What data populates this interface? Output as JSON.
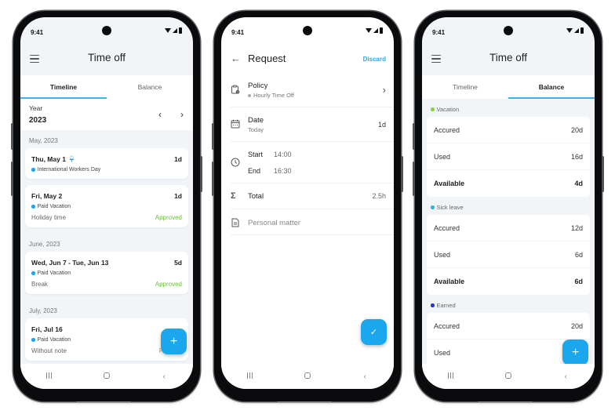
{
  "status_bar": {
    "time": "9:41"
  },
  "screen1": {
    "title": "Time off",
    "tabs": [
      {
        "label": "Timeline",
        "active": true
      },
      {
        "label": "Balance",
        "active": false
      }
    ],
    "year": {
      "label": "Year",
      "value": "2023",
      "prev": "‹",
      "next": "›"
    },
    "groups": [
      {
        "month": "May, 2023",
        "items": [
          {
            "date": "Thu, May 1",
            "days": "1d",
            "type": "International Workers Day",
            "dot_color": "#1aa7ee",
            "holiday": true,
            "note": "",
            "status": ""
          },
          {
            "date": "Fri, May 2",
            "days": "1d",
            "type": "Paid Vacation",
            "dot_color": "#1aa7ee",
            "holiday": false,
            "note": "Holiday time",
            "status": "Approved"
          }
        ]
      },
      {
        "month": "June, 2023",
        "items": [
          {
            "date": "Wed, Jun 7 - Tue, Jun 13",
            "days": "5d",
            "type": "Paid Vacation",
            "dot_color": "#1aa7ee",
            "holiday": false,
            "note": "Break",
            "status": "Approved"
          }
        ]
      },
      {
        "month": "July, 2023",
        "items": [
          {
            "date": "Fri, Jul 16",
            "days": "",
            "type": "Paid Vacation",
            "dot_color": "#1aa7ee",
            "holiday": false,
            "note": "Without note",
            "status": "Pending"
          }
        ]
      }
    ],
    "fab_icon": "+"
  },
  "screen2": {
    "title": "Request",
    "back_icon": "←",
    "discard": "Discard",
    "policy": {
      "label": "Policy",
      "value": "Hourly Time Off",
      "chevron": "›"
    },
    "date": {
      "label": "Date",
      "value": "Today",
      "days": "1d"
    },
    "start": {
      "label": "Start",
      "value": "14:00"
    },
    "end": {
      "label": "End",
      "value": "16:30"
    },
    "total": {
      "label": "Total",
      "value": "2.5h"
    },
    "note": {
      "placeholder": "Personal matter"
    },
    "fab_icon": "✓"
  },
  "screen3": {
    "title": "Time off",
    "tabs": [
      {
        "label": "Timeline",
        "active": false
      },
      {
        "label": "Balance",
        "active": true
      }
    ],
    "groups": [
      {
        "name": "Vacation",
        "dot_color": "#8bd03d",
        "rows": [
          {
            "label": "Accured",
            "value": "20d"
          },
          {
            "label": "Used",
            "value": "16d"
          },
          {
            "label": "Available",
            "value": "4d"
          }
        ]
      },
      {
        "name": "Sick leave",
        "dot_color": "#2fb3e0",
        "rows": [
          {
            "label": "Accured",
            "value": "12d"
          },
          {
            "label": "Used",
            "value": "6d"
          },
          {
            "label": "Available",
            "value": "6d"
          }
        ]
      },
      {
        "name": "Earned",
        "dot_color": "#2434d6",
        "rows": [
          {
            "label": "Accured",
            "value": "20d"
          },
          {
            "label": "Used",
            "value": ""
          }
        ]
      }
    ],
    "fab_icon": "+"
  },
  "nav": {
    "back": "‹"
  },
  "colors": {
    "accent": "#1aa7ee",
    "approved": "#6cbf3a",
    "pending": "#f29b14",
    "discard": "#2aa9ec"
  }
}
